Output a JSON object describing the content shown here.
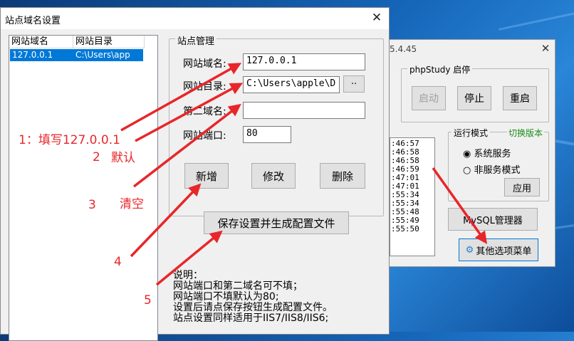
{
  "desktop": {},
  "background_window": {
    "version_fragment": "5.4.45",
    "close_glyph": "✕",
    "phpstudy_group": {
      "title": "phpStudy 启停",
      "start_label": "启动",
      "stop_label": "停止",
      "restart_label": "重启"
    },
    "log_lines": [
      ":46:57",
      ":46:58",
      ":46:58",
      ":46:59",
      ":47:01",
      ":47:01",
      ":55:34",
      ":55:34",
      ":55:48",
      ":55:49",
      ":55:50"
    ],
    "run_mode_group": {
      "title": "运行模式",
      "switch_version": "切换版本",
      "option_system_service": "系统服务",
      "option_non_service": "非服务模式",
      "selected": "系统服务",
      "apply_label": "应用"
    },
    "mysql_manager_label": "MySQL管理器",
    "other_options_label": "其他选项菜单"
  },
  "dialog": {
    "title": "站点域名设置",
    "close_glyph": "✕",
    "list": {
      "columns": [
        "网站域名",
        "网站目录"
      ],
      "rows": [
        [
          "127.0.0.1",
          "C:\\Users\\app"
        ]
      ]
    },
    "group_title": "站点管理",
    "fields": {
      "domain_label": "网站域名:",
      "domain_value": "127.0.0.1",
      "dir_label": "网站目录:",
      "dir_value": "C:\\Users\\apple\\D",
      "browse_label": "··",
      "second_domain_label": "第二域名:",
      "second_domain_value": "",
      "port_label": "网站端口:",
      "port_value": "80"
    },
    "buttons": {
      "add": "新增",
      "modify": "修改",
      "delete": "删除",
      "save": "保存设置并生成配置文件"
    },
    "notes": [
      "说明：",
      "网站端口和第二域名可不填；",
      "网站端口不填默认为80;",
      "设置后请点保存按钮生成配置文件。",
      "站点设置同样适用于IIS7/IIS8/IIS6;"
    ]
  },
  "annotations": {
    "colors": {
      "arrow": "#e8262a"
    },
    "a1": "1：填写127.0.0.1",
    "a2_num": "2",
    "a2_text": "默认",
    "a3_num": "3",
    "a3_text": "清空",
    "a4": "4",
    "a5": "5"
  }
}
